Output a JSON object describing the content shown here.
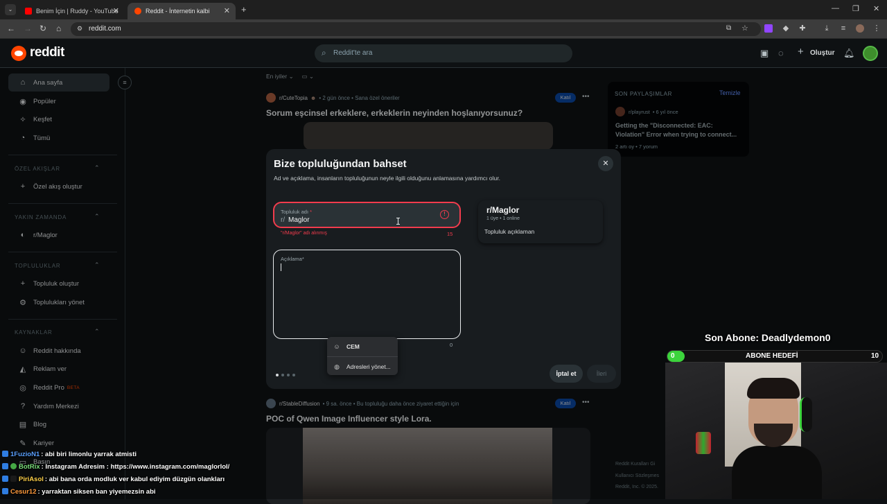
{
  "browser": {
    "tabs": [
      {
        "title": "Benim İçin | Ruddy - YouTube",
        "favicon_color": "#ff0000"
      },
      {
        "title": "Reddit - İnternetin kalbi",
        "favicon_color": "#ff4500"
      }
    ],
    "url": "reddit.com"
  },
  "reddit": {
    "brand": "reddit",
    "search_placeholder": "Reddit'te ara",
    "create_label": "Oluştur"
  },
  "sidebar": {
    "items": [
      {
        "label": "Ana sayfa",
        "icon": "home-icon"
      },
      {
        "label": "Popüler",
        "icon": "popular-icon"
      },
      {
        "label": "Keşfet",
        "icon": "explore-icon"
      },
      {
        "label": "Tümü",
        "icon": "all-icon"
      }
    ],
    "custom_feeds": {
      "heading": "ÖZEL AKIŞLAR",
      "create": "Özel akış oluştur"
    },
    "recent": {
      "heading": "YAKIN ZAMANDA",
      "item": "r/Maglor"
    },
    "communities": {
      "heading": "TOPLULUKLAR",
      "create": "Topluluk oluştur",
      "manage": "Toplulukları yönet"
    },
    "resources": {
      "heading": "KAYNAKLAR",
      "items": [
        "Reddit hakkında",
        "Reklam ver",
        "Reddit Pro",
        "Yardım Merkezi",
        "Blog",
        "Kariyer",
        "Basın"
      ],
      "beta": "BETA"
    }
  },
  "feed": {
    "sort": "En iyiler",
    "posts": [
      {
        "subreddit": "r/CuteTopia",
        "meta": "• 2 gün önce • Sana özel öneriler",
        "title": "Sorum eşcinsel erkeklere, erkeklerin neyinden hoşlanıyorsunuz?",
        "join": "Katıl"
      },
      {
        "subreddit": "r/StableDiffusion",
        "meta": "• 9 sa. önce • Bu topluluğu daha önce ziyaret ettiğin için",
        "title": "POC of Qwen Image Influencer style Lora.",
        "join": "Katıl"
      }
    ]
  },
  "recent_posts": {
    "heading": "SON PAYLAŞIMLAR",
    "clear": "Temizle",
    "subreddit": "r/playrust",
    "time": "• 6 yıl önce",
    "title": "Getting the \"Disconnected: EAC: Violation\" Error when trying to connect...",
    "stats": "2 artı oy • 7 yorum"
  },
  "footer": {
    "line1": "Reddit Kuralları  Gi",
    "line2": "Kullanıcı Sözleşmes",
    "line3": "Reddit, Inc. © 2025."
  },
  "modal": {
    "title": "Bize topluluğundan bahset",
    "subtitle": "Ad ve açıklama, insanların topluluğunun neyle ilgili olduğunu anlamasına yardımcı olur.",
    "name_label": "Topluluk adı",
    "required": "*",
    "name_prefix": "r/",
    "name_value": "Maglor",
    "name_error": "\"r/Maglor\" adı alınmış",
    "name_count": "15",
    "desc_label": "Açıklama",
    "desc_count": "0",
    "preview_name": "r/Maglor",
    "preview_stats": "1 üye  •  1 online",
    "preview_desc": "Topluluk açıklaman",
    "cancel": "İptal et",
    "next": "İleri"
  },
  "autofill": {
    "items": [
      {
        "label": "CEM",
        "icon": "person-icon"
      },
      {
        "label": "Adresleri yönet...",
        "icon": "chrome-icon"
      }
    ]
  },
  "stream": {
    "last_sub": "Son Abone: Deadlydemon0",
    "goal_label": "ABONE HEDEFİ",
    "goal_current": "0",
    "goal_target": "10",
    "goal_fraction": 0.08,
    "accent": "#3cd43c"
  },
  "chat": [
    {
      "nick": "1FuzioN1",
      "msg": ": abi biri limonlu yarrak atmisti",
      "color": "#5aa0ff"
    },
    {
      "nick": "BotRix",
      "msg": ": Instagram Adresim : https://www.instagram.com/maglorlol/",
      "color": "#7be07b"
    },
    {
      "nick": "PiriAsol",
      "msg": ": abi bana orda modluk ver kabul ediyim düzgün olankları",
      "color": "#ffd24a"
    },
    {
      "nick": "Cesur12",
      "msg": ": yarraktan siksen ban yiyemezsin abi",
      "color": "#ff9a3c"
    }
  ]
}
